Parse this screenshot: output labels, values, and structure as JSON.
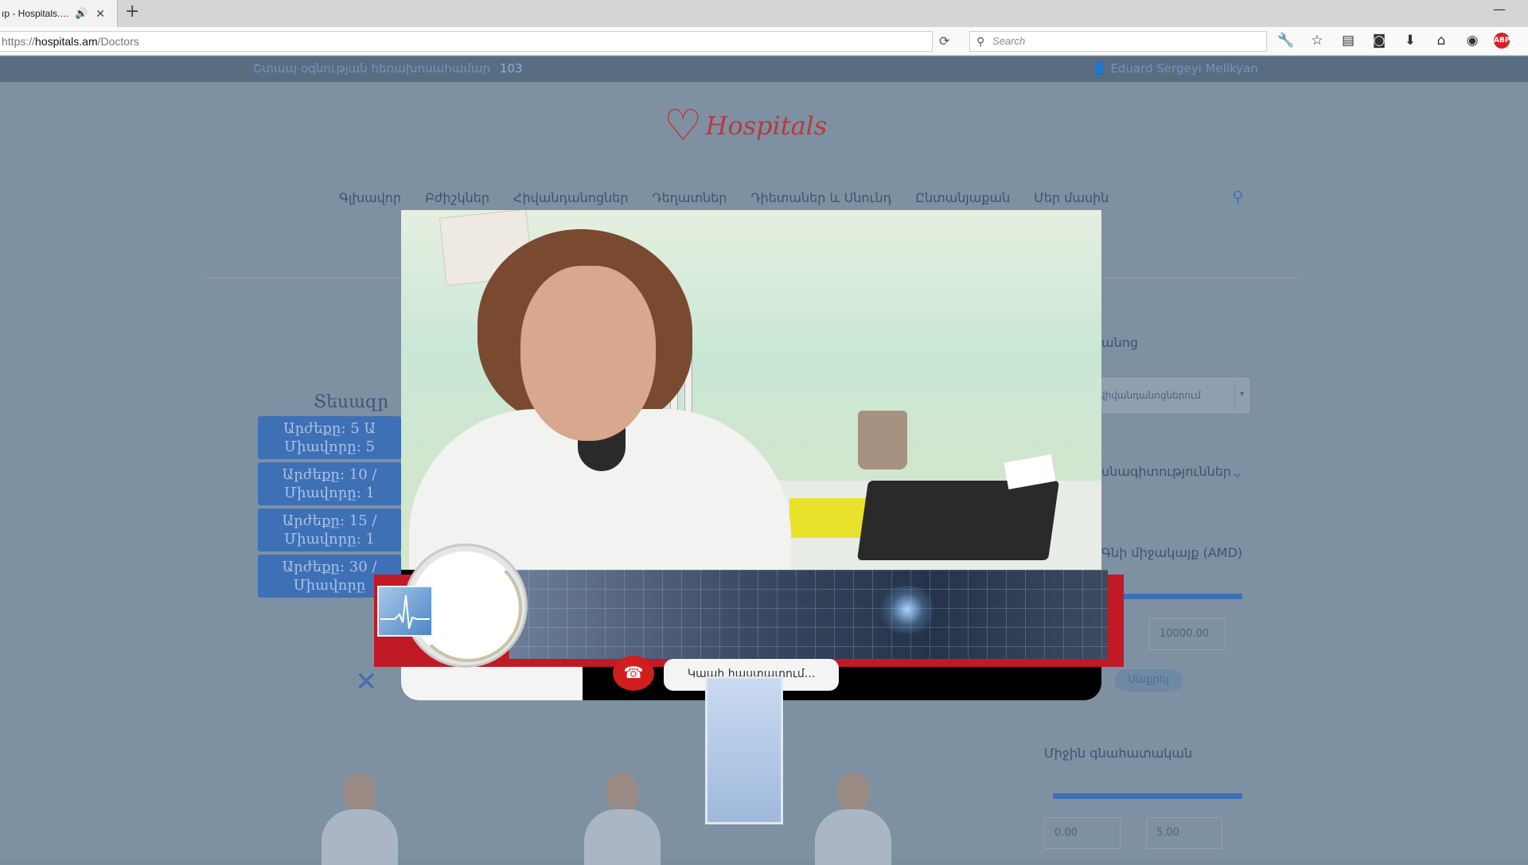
{
  "browser": {
    "tab_title": "ıp - Hospitals.…",
    "tab_audio_icon": "speaker-icon",
    "url_scheme": "https://",
    "url_host": "hospitals.am",
    "url_path": "/Doctors",
    "search_placeholder": "Search"
  },
  "site": {
    "hotline_text": "Շտապ օգնության հեռախոսահամար",
    "hotline_number": "103",
    "user_name": "Eduard Sergeyi Melikyan",
    "logo_text": "Hospitals",
    "menu": [
      "Գլխավոր",
      "Բժիշկներ",
      "Հիվանդանոցներ",
      "Դեղատներ",
      "Դիետաներ և Սնունդ",
      "Ընտանյաքան",
      "Մեր մասին"
    ],
    "tariffs_title": "Տեսազր",
    "tariffs": [
      {
        "line1": "Արժեքը: 5 Ա",
        "line2": "Միավորը: 5"
      },
      {
        "line1": "Արժեքը: 10 /",
        "line2": "Միավորը: 1"
      },
      {
        "line1": "Արժեքը: 15 /",
        "line2": "Միավորը: 1"
      },
      {
        "line1": "Արժեքը: 30 /",
        "line2": "Միավորը"
      }
    ],
    "filters": {
      "hospital_label": "անոց",
      "hospital_select": "վիվանդանոցներում",
      "specialty_label": "սնագիտություններ",
      "price_label": "Գնի միջակայք (AMD)",
      "price_max": "10000.00",
      "filter_button": "Մաքրել",
      "rating_label": "Միջին գնահատական",
      "rating_min": "0.00",
      "rating_max": "5.00"
    }
  },
  "call": {
    "status_text": "Կապի հաստատում...",
    "hangup_icon": "phone-hangup-icon"
  },
  "colors": {
    "brand_red": "#c3343a",
    "accent_blue": "#3e70b6",
    "hangup_red": "#d01d1d"
  }
}
